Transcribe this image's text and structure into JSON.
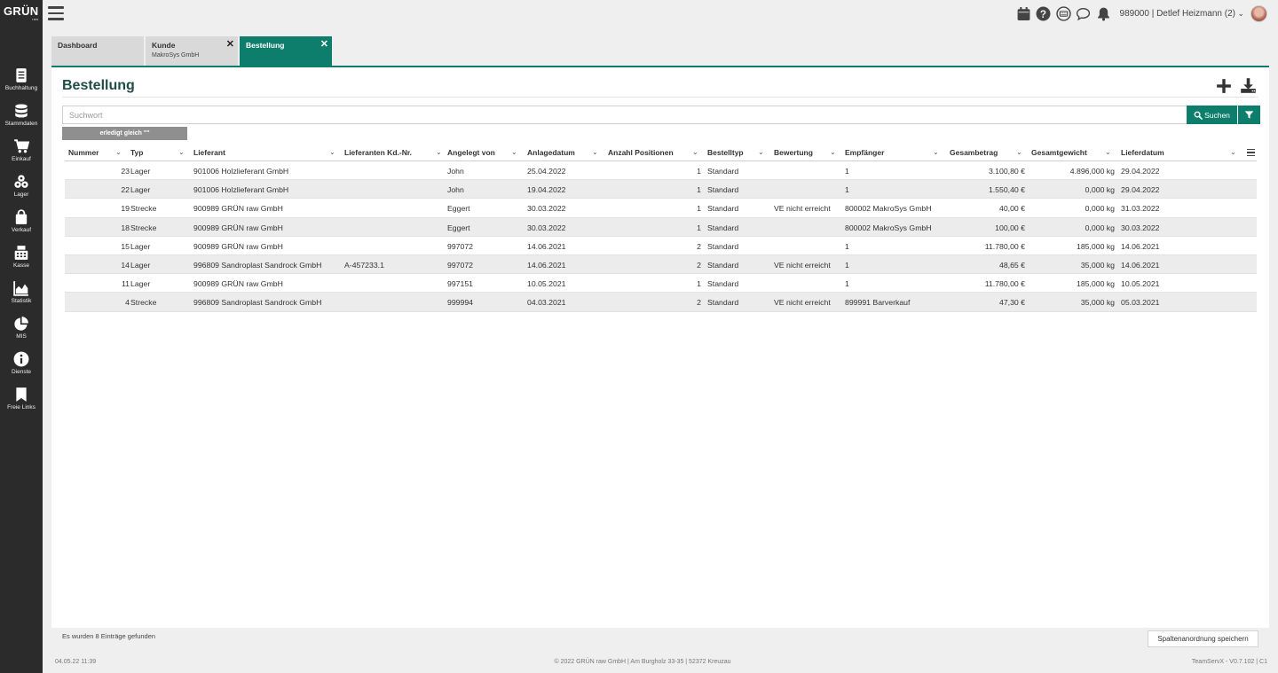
{
  "brand": {
    "logo": "GRÜN",
    "logo_sub": "raw"
  },
  "sidebar": {
    "items": [
      {
        "label": "Buchhaltung",
        "icon": "ledger-icon"
      },
      {
        "label": "Stammdaten",
        "icon": "database-icon"
      },
      {
        "label": "Einkauf",
        "icon": "cart-icon"
      },
      {
        "label": "Lager",
        "icon": "boxes-icon"
      },
      {
        "label": "Verkauf",
        "icon": "shopping-bag-icon"
      },
      {
        "label": "Kasse",
        "icon": "cash-register-icon"
      },
      {
        "label": "Statistik",
        "icon": "area-chart-icon"
      },
      {
        "label": "MIS",
        "icon": "pie-chart-icon"
      },
      {
        "label": "Dienste",
        "icon": "info-icon"
      },
      {
        "label": "Freie Links",
        "icon": "bookmark-icon"
      }
    ]
  },
  "topbar": {
    "user": "989000 | Detlef Heizmann (2)",
    "icons": [
      "calendar-icon",
      "help-icon",
      "keyboard-icon",
      "chat-icon",
      "bell-icon"
    ]
  },
  "tabs": [
    {
      "title": "Dashboard",
      "subtitle": ""
    },
    {
      "title": "Kunde",
      "subtitle": "MakroSys GmbH"
    },
    {
      "title": "Bestellung",
      "subtitle": ""
    }
  ],
  "page": {
    "title": "Bestellung",
    "search_placeholder": "Suchwort",
    "search_button": "Suchen",
    "filter_chip": "erledigt gleich \"\""
  },
  "table": {
    "columns": [
      "Nummer",
      "Typ",
      "Lieferant",
      "Lieferanten Kd.-Nr.",
      "Angelegt von",
      "Anlagedatum",
      "Anzahl Positionen",
      "Bestelltyp",
      "Bewertung",
      "Empfänger",
      "Gesambetrag",
      "Gesamtgewicht",
      "Lieferdatum"
    ],
    "rows": [
      [
        "23",
        "Lager",
        "901006 Holzlieferant GmbH",
        "",
        "John",
        "25.04.2022",
        "1",
        "Standard",
        "",
        "1",
        "3.100,80 €",
        "4.896,000 kg",
        "29.04.2022"
      ],
      [
        "22",
        "Lager",
        "901006 Holzlieferant GmbH",
        "",
        "John",
        "19.04.2022",
        "1",
        "Standard",
        "",
        "1",
        "1.550,40 €",
        "0,000 kg",
        "29.04.2022"
      ],
      [
        "19",
        "Strecke",
        "900989 GRÜN raw GmbH",
        "",
        "Eggert",
        "30.03.2022",
        "1",
        "Standard",
        "VE nicht erreicht",
        "800002 MakroSys GmbH",
        "40,00 €",
        "0,000 kg",
        "31.03.2022"
      ],
      [
        "18",
        "Strecke",
        "900989 GRÜN raw GmbH",
        "",
        "Eggert",
        "30.03.2022",
        "1",
        "Standard",
        "",
        "800002 MakroSys GmbH",
        "100,00 €",
        "0,000 kg",
        "30.03.2022"
      ],
      [
        "15",
        "Lager",
        "900989 GRÜN raw GmbH",
        "",
        "997072",
        "14.06.2021",
        "2",
        "Standard",
        "",
        "1",
        "11.780,00 €",
        "185,000 kg",
        "14.06.2021"
      ],
      [
        "14",
        "Lager",
        "996809 Sandroplast Sandrock GmbH",
        "A-457233.1",
        "997072",
        "14.06.2021",
        "2",
        "Standard",
        "VE nicht erreicht",
        "1",
        "48,65 €",
        "35,000 kg",
        "14.06.2021"
      ],
      [
        "11",
        "Lager",
        "900989 GRÜN raw GmbH",
        "",
        "997151",
        "10.05.2021",
        "1",
        "Standard",
        "",
        "1",
        "11.780,00 €",
        "185,000 kg",
        "10.05.2021"
      ],
      [
        "4",
        "Strecke",
        "996809 Sandroplast Sandrock GmbH",
        "",
        "999994",
        "04.03.2021",
        "2",
        "Standard",
        "VE nicht erreicht",
        "899991 Barverkauf",
        "47,30 €",
        "35,000 kg",
        "05.03.2021"
      ]
    ]
  },
  "status": {
    "count_text": "Es wurden 8 Einträge gefunden",
    "save_columns_button": "Spaltenanordnung speichern"
  },
  "footer": {
    "left": "04.05.22 11:39",
    "center": "© 2022 GRÜN raw GmbH | Am Burgholz 33-35 | 52372 Kreuzau",
    "right": "TeamServX - V0.7.102 | C1"
  },
  "colors": {
    "accent": "#0e7e6c",
    "sidebar": "#2b2b2b",
    "title": "#1f4d45"
  }
}
